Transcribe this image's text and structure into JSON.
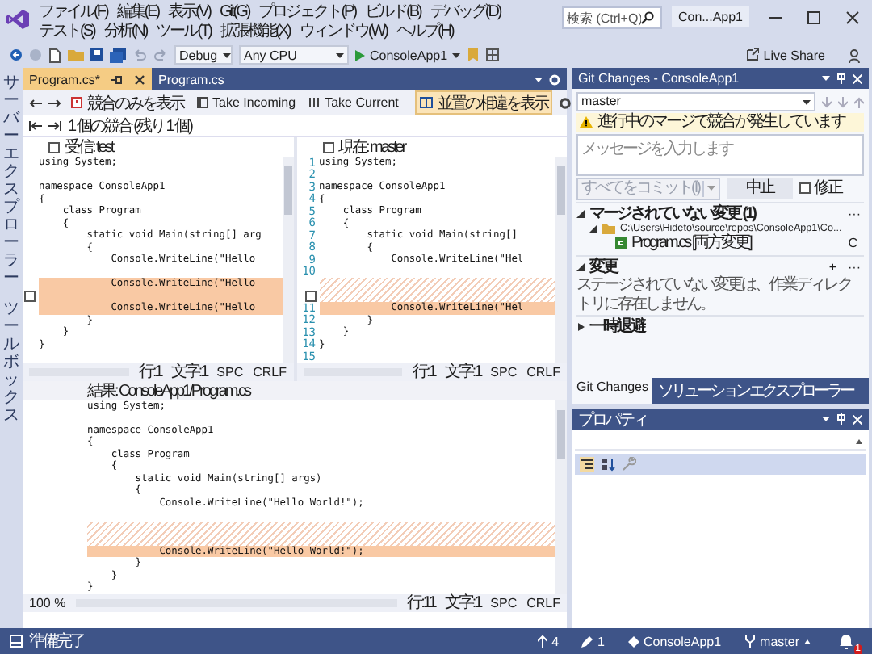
{
  "menu": [
    "ファイル(F)",
    "編集(E)",
    "表示(V)",
    "Git(G)",
    "プロジェクト(P)",
    "ビルド(B)",
    "デバッグ(D)",
    "テスト(S)",
    "分析(N)",
    "ツール(T)",
    "拡張機能(X)",
    "ウィンドウ(W)",
    "ヘルプ(H)"
  ],
  "search": {
    "placeholder": "検索 (Ctrl+Q)"
  },
  "window": {
    "title": "Con...App1"
  },
  "toolbar": {
    "configuration": "Debug",
    "platform": "Any CPU",
    "start": "ConsoleApp1",
    "live_share": "Live Share"
  },
  "side_tabs": [
    "サーバーエクスプローラー",
    "ツールボックス"
  ],
  "doc_tabs": [
    {
      "label": "Program.cs*",
      "selected": true
    },
    {
      "label": "Program.cs",
      "selected": false
    }
  ],
  "merge_toolbar": {
    "buttons": [
      {
        "label": "競合のみを表示",
        "kind": "conflicts"
      },
      {
        "label": "Take Incoming",
        "kind": "incoming"
      },
      {
        "label": "Take Current",
        "kind": "current"
      }
    ],
    "diff_toggle": {
      "label": "並置の相違を表示",
      "on": true
    }
  },
  "conflict_summary": "1 個の競合 (残り 1 個)",
  "incoming": {
    "header": {
      "label": "受信: test",
      "checked": false
    },
    "lines": [
      {
        "kind": "normal",
        "text": "using System;"
      },
      {
        "kind": "normal"
      },
      {
        "kind": "normal",
        "text": "namespace ConsoleApp1"
      },
      {
        "kind": "normal",
        "text": "{"
      },
      {
        "kind": "normal",
        "text": "    class Program"
      },
      {
        "kind": "normal",
        "text": "    {"
      },
      {
        "kind": "normal",
        "text": "        static void Main(string[] arg"
      },
      {
        "kind": "normal",
        "text": "        {"
      },
      {
        "kind": "normal",
        "text": "            Console.WriteLine(\"Hello"
      },
      {
        "kind": "normal"
      },
      {
        "kind": "conflict",
        "text": "            Console.WriteLine(\"Hello"
      },
      {
        "kind": "conflict",
        "checkbox": false
      },
      {
        "kind": "conflict",
        "text": "            Console.WriteLine(\"Hello"
      },
      {
        "kind": "normal",
        "text": "        }"
      },
      {
        "kind": "normal",
        "text": "    }"
      },
      {
        "kind": "normal",
        "text": "}"
      },
      {
        "kind": "normal"
      }
    ],
    "status": [
      "行:1",
      "文字:1",
      "SPC",
      "CRLF"
    ]
  },
  "current": {
    "header": {
      "label": "現在: master",
      "checked": false
    },
    "lines": [
      {
        "kind": "normal",
        "number": "1",
        "text": "using System;"
      },
      {
        "kind": "normal",
        "number": "2"
      },
      {
        "kind": "normal",
        "number": "3",
        "text": "namespace ConsoleApp1"
      },
      {
        "kind": "normal",
        "number": "4",
        "text": "{"
      },
      {
        "kind": "normal",
        "number": "5",
        "text": "    class Program"
      },
      {
        "kind": "normal",
        "number": "6",
        "text": "    {"
      },
      {
        "kind": "normal",
        "number": "7",
        "text": "        static void Main(string[]"
      },
      {
        "kind": "normal",
        "number": "8",
        "text": "        {"
      },
      {
        "kind": "normal",
        "number": "9",
        "text": "            Console.WriteLine(\"Hel"
      },
      {
        "kind": "normal",
        "number": "10"
      },
      {
        "kind": "gap"
      },
      {
        "kind": "gap",
        "checkbox": false
      },
      {
        "kind": "conflict",
        "number": "11",
        "text": "            Console.WriteLine(\"Hel"
      },
      {
        "kind": "normal",
        "number": "12",
        "text": "        }"
      },
      {
        "kind": "normal",
        "number": "13",
        "text": "    }"
      },
      {
        "kind": "normal",
        "number": "14",
        "text": "}"
      },
      {
        "kind": "normal",
        "number": "15"
      }
    ],
    "status": [
      "行:1",
      "文字:1",
      "SPC",
      "CRLF"
    ]
  },
  "result": {
    "header": {
      "label": "結果: ConsoleApp1/Program.cs"
    },
    "lines": [
      {
        "kind": "normal",
        "text": "using System;"
      },
      {
        "kind": "normal"
      },
      {
        "kind": "normal",
        "text": "namespace ConsoleApp1"
      },
      {
        "kind": "normal",
        "text": "{"
      },
      {
        "kind": "normal",
        "text": "    class Program"
      },
      {
        "kind": "normal",
        "text": "    {"
      },
      {
        "kind": "normal",
        "text": "        static void Main(string[] args)"
      },
      {
        "kind": "normal",
        "text": "        {"
      },
      {
        "kind": "normal",
        "text": "            Console.WriteLine(\"Hello World!\");"
      },
      {
        "kind": "normal"
      },
      {
        "kind": "gap"
      },
      {
        "kind": "gap"
      },
      {
        "kind": "conflict",
        "text": "            Console.WriteLine(\"Hello World!\");"
      },
      {
        "kind": "normal",
        "text": "        }"
      },
      {
        "kind": "normal",
        "text": "    }"
      },
      {
        "kind": "normal",
        "text": "}"
      }
    ],
    "zoom": "100 %",
    "status": [
      "行:11",
      "文字:1",
      "SPC",
      "CRLF"
    ]
  },
  "git_changes": {
    "title": "Git Changes - ConsoleApp1",
    "branch": "master",
    "warning": "進行中のマージで競合が発生しています",
    "message": {
      "placeholder": "メッセージを入力します"
    },
    "commit_button": {
      "label": "すべてをコミット(I)",
      "disabled": true
    },
    "abort_button": "中止",
    "amend": {
      "label": "修正",
      "checked": false
    },
    "sections": [
      {
        "title": "マージされていない変更 (1)",
        "expanded": true,
        "actions": [
          "···"
        ],
        "items": [
          {
            "label": "C:\\Users\\Hideto\\source\\repos\\ConsoleApp1\\Co...",
            "kind": "folder",
            "expanded": true,
            "children": [
              {
                "label": "Program.cs [両方変更]",
                "kind": "file",
                "badge": "C"
              }
            ]
          }
        ]
      },
      {
        "title": "変更",
        "expanded": true,
        "actions": [
          "+",
          "···"
        ],
        "note": "ステージされていない変更は、作業ディレクトリに存在しません。"
      },
      {
        "title": "一時退避",
        "expanded": false
      }
    ],
    "tabs": [
      {
        "label": "Git Changes",
        "selected": true
      },
      {
        "label": "ソリューション エクスプローラー",
        "selected": false
      }
    ]
  },
  "properties": {
    "title": "プロパティ"
  },
  "status_bar": {
    "text": "準備完了",
    "push": "4",
    "edits": "1",
    "project": "ConsoleApp1",
    "branch": "master",
    "notifications": "1"
  }
}
